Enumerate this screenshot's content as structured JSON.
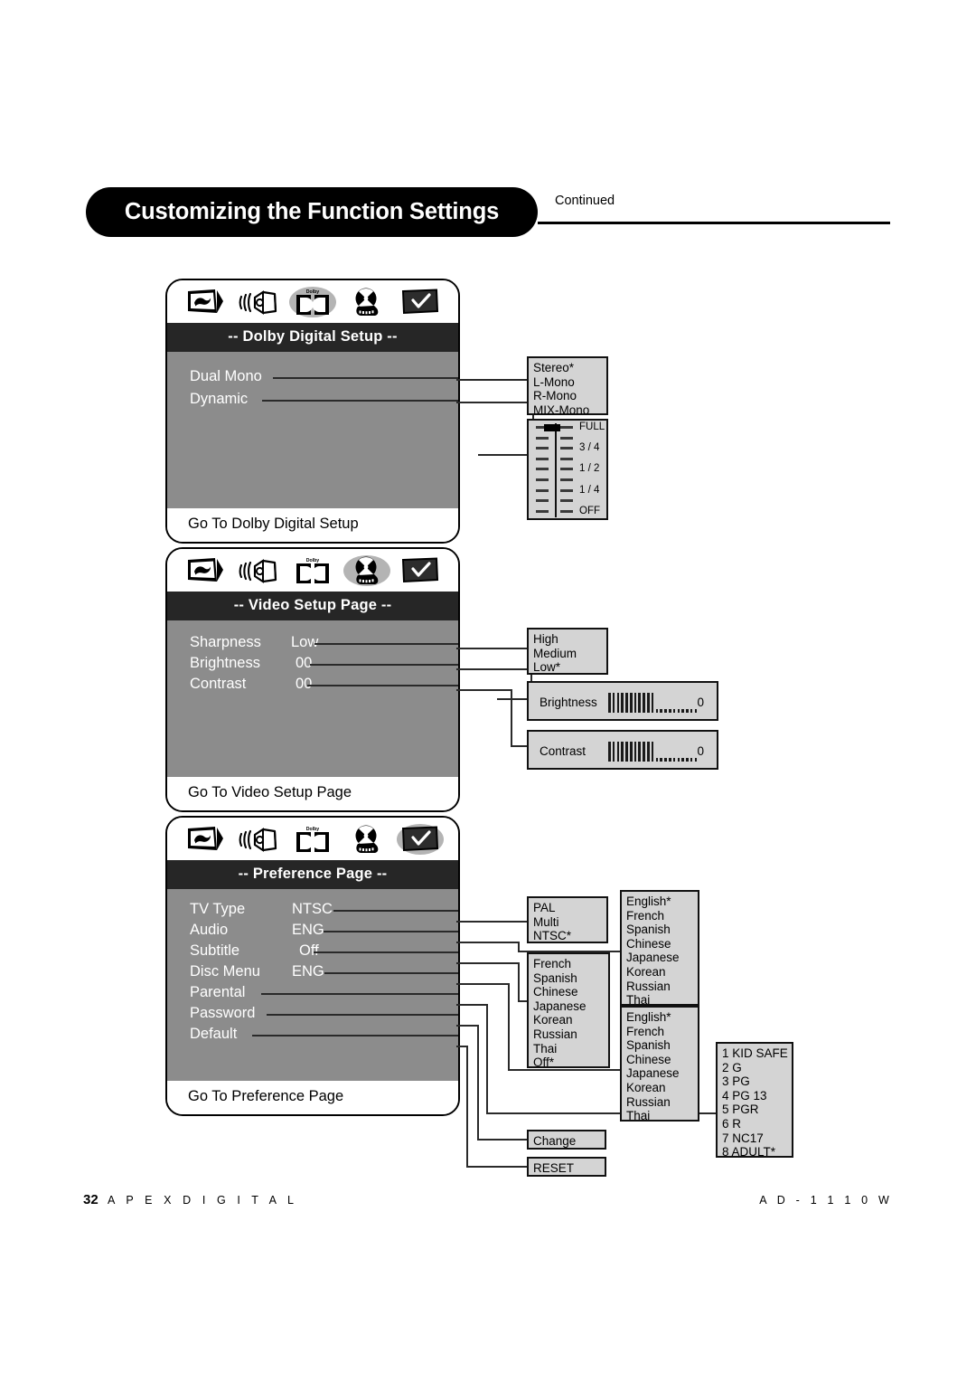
{
  "header": {
    "title": "Customizing the Function Settings",
    "continued": "Continued"
  },
  "footer": {
    "page_number": "32",
    "brand": "A P E X   D I G I T A L",
    "model": "A D - 1 1 1 0 W"
  },
  "icons": {
    "names": [
      "tv-screen-icon",
      "speaker-icon",
      "dolby-digital-icon",
      "film-reel-icon",
      "checkmark-screen-icon"
    ]
  },
  "panels": [
    {
      "name": "dolby-digital-setup",
      "title": "-- Dolby Digital Setup --",
      "footer": "Go To Dolby Digital Setup",
      "active_icon_index": 2,
      "rows": [
        {
          "label": "Dual Mono",
          "value": ""
        },
        {
          "label": "Dynamic",
          "value": ""
        }
      ]
    },
    {
      "name": "video-setup-page",
      "title": "-- Video Setup Page --",
      "footer": "Go To Video Setup Page",
      "active_icon_index": 3,
      "rows": [
        {
          "label": "Sharpness",
          "value": "Low"
        },
        {
          "label": "Brightness",
          "value": "00"
        },
        {
          "label": "Contrast",
          "value": "00"
        }
      ]
    },
    {
      "name": "preference-page",
      "title": "-- Preference Page --",
      "footer": "Go To Preference Page",
      "active_icon_index": 4,
      "rows": [
        {
          "label": "TV Type",
          "value": "NTSC"
        },
        {
          "label": "Audio",
          "value": "ENG"
        },
        {
          "label": "Subtitle",
          "value": "Off"
        },
        {
          "label": "Disc Menu",
          "value": "ENG"
        },
        {
          "label": "Parental",
          "value": ""
        },
        {
          "label": "Password",
          "value": ""
        },
        {
          "label": "Default",
          "value": ""
        }
      ]
    }
  ],
  "callouts": {
    "dual_mono": {
      "name": "dual-mono-options",
      "items": [
        "Stereo*",
        "L-Mono",
        "R-Mono",
        "MIX-Mono"
      ]
    },
    "dynamic": {
      "name": "dynamic-range-slider",
      "labels": [
        "FULL",
        "3 / 4",
        "1 / 2",
        "1 / 4",
        "OFF"
      ],
      "selected": "FULL"
    },
    "sharpness": {
      "name": "sharpness-options",
      "items": [
        "High",
        "Medium",
        "Low*"
      ]
    },
    "brightness": {
      "name": "brightness-bar",
      "label": "Brightness",
      "value": "0",
      "filled_bars": 11,
      "empty_bars": 10
    },
    "contrast": {
      "name": "contrast-bar",
      "label": "Contrast",
      "value": "0",
      "filled_bars": 11,
      "empty_bars": 10
    },
    "tv_type": {
      "name": "tv-type-options",
      "items": [
        "PAL",
        "Multi",
        "NTSC*"
      ]
    },
    "audio": {
      "name": "audio-language-options",
      "items": [
        "English*",
        "French",
        "Spanish",
        "Chinese",
        "Japanese",
        "Korean",
        "Russian",
        "Thai"
      ]
    },
    "subtitle": {
      "name": "subtitle-language-options",
      "items": [
        "French",
        "Spanish",
        "Chinese",
        "Japanese",
        "Korean",
        "Russian",
        "Thai",
        "Off*"
      ]
    },
    "disc_menu": {
      "name": "disc-menu-language-options",
      "items": [
        "English*",
        "French",
        "Spanish",
        "Chinese",
        "Japanese",
        "Korean",
        "Russian",
        "Thai"
      ]
    },
    "parental": {
      "name": "parental-rating-options",
      "items": [
        "1  KID SAFE",
        "2  G",
        "3  PG",
        "4  PG 13",
        "5  PGR",
        "6  R",
        "7  NC17",
        "8  ADULT*"
      ]
    },
    "password": {
      "name": "password-change-option",
      "items": [
        "Change"
      ]
    },
    "default": {
      "name": "default-reset-option",
      "items": [
        "RESET"
      ]
    }
  }
}
